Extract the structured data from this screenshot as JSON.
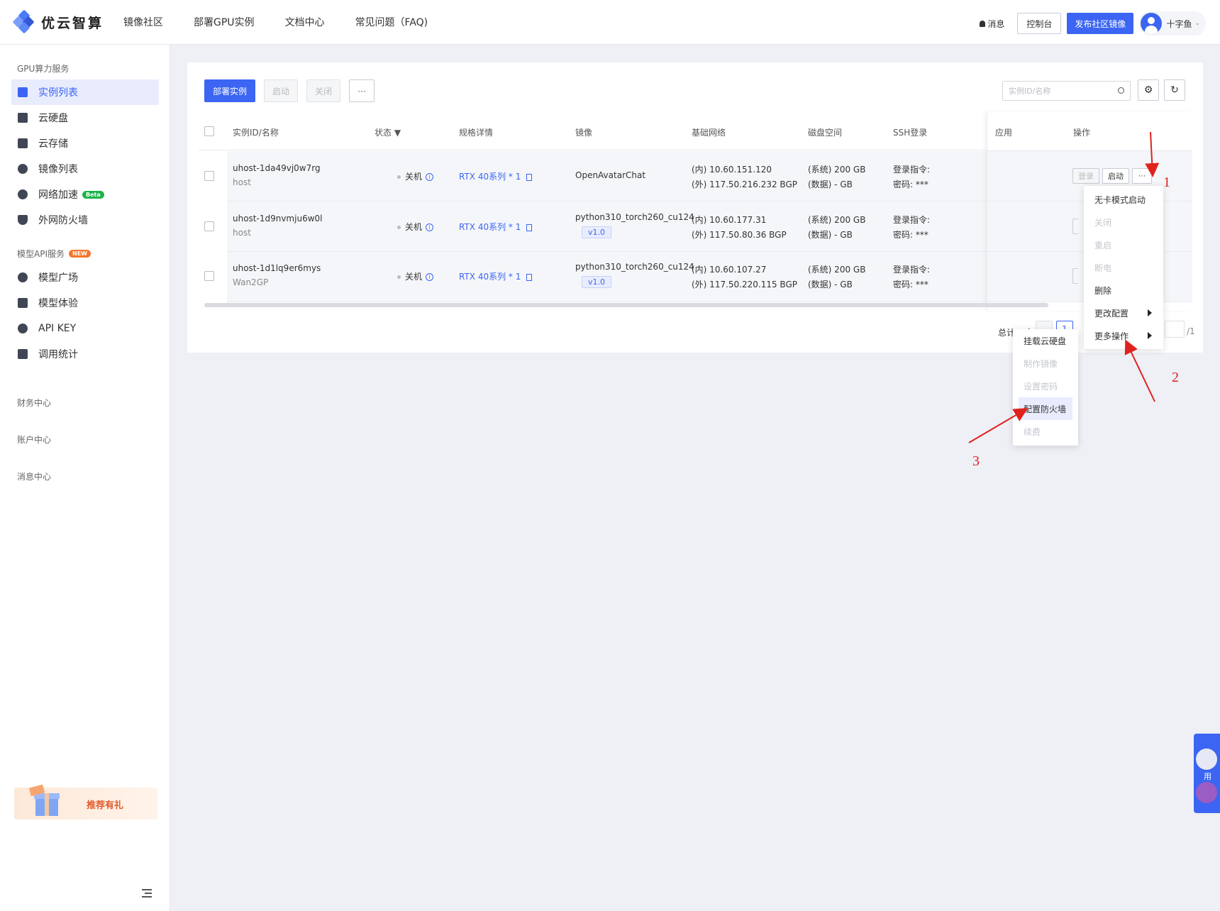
{
  "header": {
    "brand": "优云智算",
    "nav": [
      "镜像社区",
      "部署GPU实例",
      "文档中心",
      "常见问题（FAQ)"
    ],
    "message": "消息",
    "console": "控制台",
    "publish": "发布社区镜像",
    "user": "十字鱼"
  },
  "sidebar": {
    "gpu_section": "GPU算力服务",
    "gpu_items": [
      "实例列表",
      "云硬盘",
      "云存储",
      "镜像列表",
      "网络加速",
      "外网防火墙"
    ],
    "beta": "Beta",
    "api_section": "模型API服务",
    "new": "NEW",
    "api_items": [
      "模型广场",
      "模型体验",
      "API KEY",
      "调用统计"
    ],
    "finance": "财务中心",
    "account": "账户中心",
    "message_center": "消息中心",
    "promo": "推荐有礼"
  },
  "toolbar": {
    "deploy": "部署实例",
    "start": "启动",
    "close": "关闭",
    "more": "···",
    "search_placeholder": "实例ID/名称"
  },
  "table": {
    "headers": [
      "实例ID/名称",
      "状态",
      "规格详情",
      "镜像",
      "基础网络",
      "磁盘空间",
      "SSH登录",
      "应用",
      "操作"
    ],
    "rows": [
      {
        "id": "uhost-1da49vj0w7rg",
        "name": "host",
        "status": "关机",
        "spec": "RTX 40系列 * 1",
        "image": "OpenAvatarChat",
        "image_tag": "",
        "net_in": "(内) 10.60.151.120",
        "net_out": "(外) 117.50.216.232 BGP",
        "disk_sys": "(系统) 200 GB",
        "disk_data": "(数据) - GB",
        "ssh_cmd": "登录指令:",
        "ssh_pwd": "密码: ***"
      },
      {
        "id": "uhost-1d9nvmju6w0l",
        "name": "host",
        "status": "关机",
        "spec": "RTX 40系列 * 1",
        "image": "python310_torch260_cu124",
        "image_tag": "v1.0",
        "net_in": "(内) 10.60.177.31",
        "net_out": "(外) 117.50.80.36 BGP",
        "disk_sys": "(系统) 200 GB",
        "disk_data": "(数据) - GB",
        "ssh_cmd": "登录指令:",
        "ssh_pwd": "密码: ***"
      },
      {
        "id": "uhost-1d1lq9er6mys",
        "name": "Wan2GP",
        "status": "关机",
        "spec": "RTX 40系列 * 1",
        "image": "python310_torch260_cu124",
        "image_tag": "v1.0",
        "net_in": "(内) 10.60.107.27",
        "net_out": "(外) 117.50.220.115 BGP",
        "disk_sys": "(系统) 200 GB",
        "disk_data": "(数据) - GB",
        "ssh_cmd": "登录指令:",
        "ssh_pwd": "密码: ***"
      }
    ],
    "op_login": "登录",
    "op_start": "启动",
    "op_more": "···"
  },
  "pagination": {
    "total": "总计 3 条",
    "page": "1",
    "pages": "/1"
  },
  "menu_main": [
    "无卡模式启动",
    "关闭",
    "重启",
    "断电",
    "删除",
    "更改配置",
    "更多操作"
  ],
  "menu_more": [
    "挂载云硬盘",
    "制作镜像",
    "设置密码",
    "配置防火墙",
    "续费"
  ],
  "float_widget": "用",
  "annotations": [
    "1",
    "2",
    "3"
  ],
  "colors": {
    "accent": "#3b65f2",
    "annotation": "#e0221c"
  }
}
